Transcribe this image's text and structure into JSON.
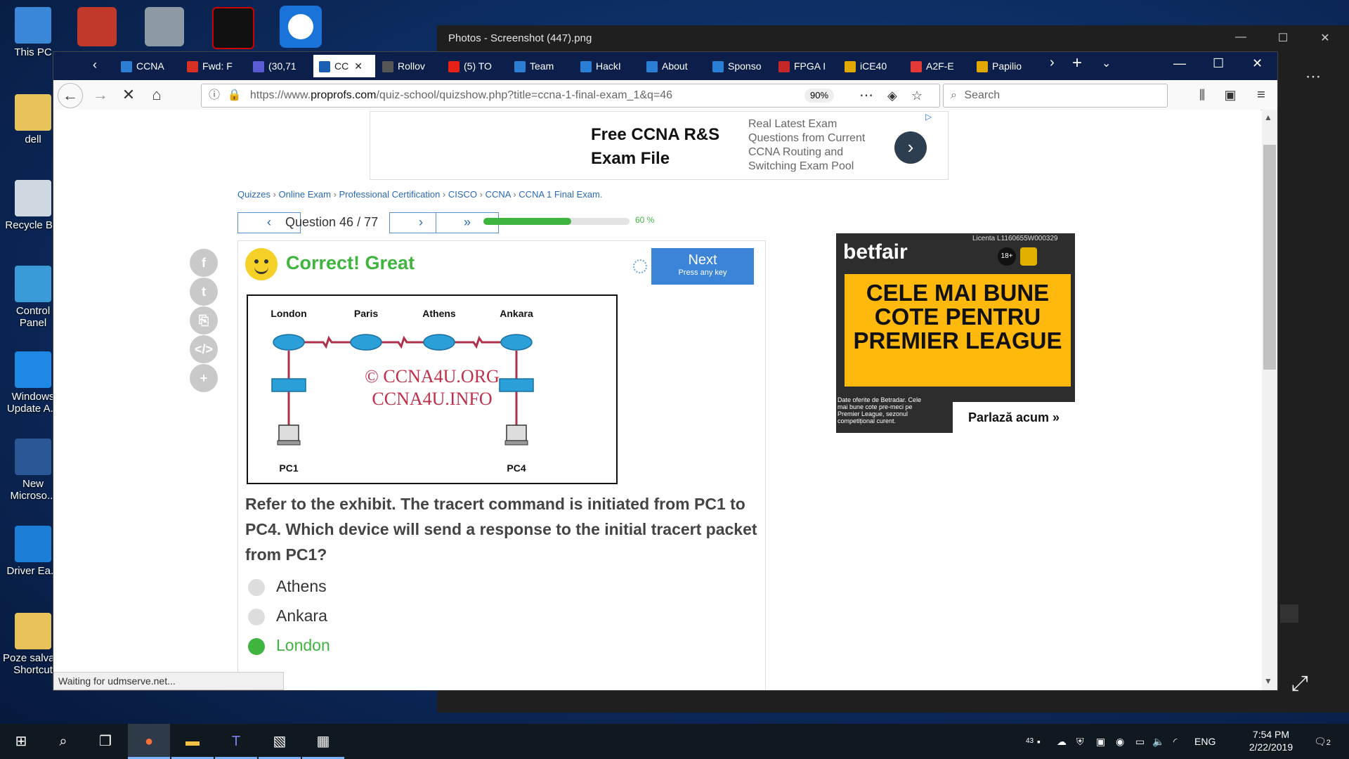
{
  "desktop_icons": [
    {
      "label": "This PC",
      "name": "this-pc-icon",
      "color": "#3a87d8"
    },
    {
      "label": "dell",
      "name": "user-folder-icon",
      "color": "#e8c25a"
    },
    {
      "label": "Recycle Bin",
      "name": "recycle-bin-icon",
      "color": "#cfd8e0"
    },
    {
      "label": "Control Panel",
      "name": "control-panel-icon",
      "color": "#3b9ad8"
    },
    {
      "label": "Windows Update A...",
      "name": "windows-update-icon",
      "color": "#1e88e5"
    },
    {
      "label": "New Microso...",
      "name": "word-document-icon",
      "color": "#2b5797"
    },
    {
      "label": "Driver Ea...",
      "name": "driver-easy-icon",
      "color": "#1c7ed6"
    },
    {
      "label": "Poze salva... Shortcut",
      "name": "folder-shortcut-icon",
      "color": "#e8c25a"
    }
  ],
  "photos": {
    "title": "Photos - Screenshot (447).png"
  },
  "tabs": [
    {
      "label": "CCNA",
      "color": "#2a7fd4"
    },
    {
      "label": "Fwd: F",
      "color": "#d93025"
    },
    {
      "label": "(30,71",
      "color": "#5b5bd6"
    },
    {
      "label": "CC",
      "color": "#1a5fb4",
      "active": true
    },
    {
      "label": "Rollov",
      "color": "#555555"
    },
    {
      "label": "(5) TO",
      "color": "#e62117"
    },
    {
      "label": "Team",
      "color": "#2a7fd4"
    },
    {
      "label": "HackI",
      "color": "#2a7fd4"
    },
    {
      "label": "About",
      "color": "#2a7fd4"
    },
    {
      "label": "Sponso",
      "color": "#2a7fd4"
    },
    {
      "label": "FPGA I",
      "color": "#c62828"
    },
    {
      "label": "iCE40",
      "color": "#e0a800"
    },
    {
      "label": "A2F-E",
      "color": "#e53935"
    },
    {
      "label": "Papilio",
      "color": "#e0a800"
    }
  ],
  "url": {
    "prefix": "https://www.",
    "domain": "proprofs.com",
    "path": "/quiz-school/quizshow.php?title=ccna-1-final-exam_1&q=46",
    "zoom": "90%"
  },
  "search": {
    "placeholder": "Search"
  },
  "ad_top": {
    "title": "Free CCNA R&S Exam File",
    "text": "Real Latest Exam Questions from Current CCNA Routing and Switching Exam Pool"
  },
  "breadcrumb": [
    "Quizzes",
    "Online Exam",
    "Professional Certification",
    "CISCO",
    "CCNA",
    "CCNA 1 Final Exam."
  ],
  "quiz": {
    "question_label": "Question 46 / 77",
    "progress": 0.6,
    "progress_text": "60 %",
    "status": "Correct! Great",
    "next_label": "Next",
    "next_sub": "Press any key",
    "question": "Refer to the exhibit. The tracert command is initiated from PC1 to PC4. Which device will send a response to the initial tracert packet from PC1?",
    "answers": [
      "Athens",
      "Ankara",
      "London"
    ],
    "exhibit": {
      "routers": [
        "London",
        "Paris",
        "Athens",
        "Ankara"
      ],
      "pcs": [
        "PC1",
        "PC4"
      ],
      "watermark1": "© CCNA4U.ORG",
      "watermark2": "CCNA4U.INFO"
    }
  },
  "ad_side": {
    "brand": "betfair",
    "license": "Licenta L1160655W000329",
    "age": "18+",
    "headline": "CELE MAI BUNE COTE PENTRU PREMIER LEAGUE",
    "small": "Date oferite de Betradar. Cele mai bune cote pre-meci pe Premier League, sezonul competițional curent.",
    "cta": "Parlază acum"
  },
  "status_bar": "Waiting for udmserve.net...",
  "taskbar": {
    "lang": "ENG",
    "time": "7:54 PM",
    "date": "2/22/2019",
    "notif": "2",
    "badge": "43"
  }
}
